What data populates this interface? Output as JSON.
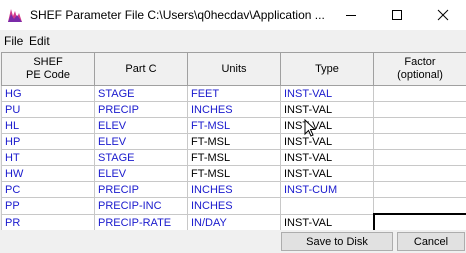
{
  "window": {
    "title": "SHEF Parameter File   C:\\Users\\q0hecdav\\Application ...",
    "icon": "hec-dss-app-icon"
  },
  "menu": [
    "File",
    "Edit"
  ],
  "table": {
    "headers": [
      {
        "line1": "SHEF",
        "line2": "PE Code"
      },
      {
        "line1": "Part C",
        "line2": ""
      },
      {
        "line1": "Units",
        "line2": ""
      },
      {
        "line1": "Type",
        "line2": ""
      },
      {
        "line1": "Factor",
        "line2": "(optional)"
      }
    ],
    "rows": [
      [
        "HG",
        "STAGE",
        "FEET",
        "INST-VAL",
        ""
      ],
      [
        "PU",
        "PRECIP",
        "INCHES",
        "INST-VAL",
        ""
      ],
      [
        "HL",
        "ELEV",
        "FT-MSL",
        "INST-VAL",
        ""
      ],
      [
        "HP",
        "ELEV",
        "FT-MSL",
        "INST-VAL",
        ""
      ],
      [
        "HT",
        "STAGE",
        "FT-MSL",
        "INST-VAL",
        ""
      ],
      [
        "HW",
        "ELEV",
        "FT-MSL",
        "INST-VAL",
        ""
      ],
      [
        "PC",
        "PRECIP",
        "INCHES",
        "INST-CUM",
        ""
      ],
      [
        "PP",
        "PRECIP-INC",
        "INCHES",
        "",
        ""
      ],
      [
        "PR",
        "PRECIP-RATE",
        "IN/DAY",
        "INST-VAL",
        ""
      ]
    ],
    "cell_colors": [
      [
        "blue",
        "blue",
        "blue",
        "blue",
        "black"
      ],
      [
        "blue",
        "blue",
        "blue",
        "black",
        "black"
      ],
      [
        "blue",
        "blue",
        "blue",
        "black",
        "black"
      ],
      [
        "blue",
        "blue",
        "black",
        "black",
        "black"
      ],
      [
        "blue",
        "blue",
        "black",
        "black",
        "black"
      ],
      [
        "blue",
        "blue",
        "black",
        "black",
        "black"
      ],
      [
        "blue",
        "blue",
        "blue",
        "blue",
        "black"
      ],
      [
        "blue",
        "blue",
        "blue",
        "black",
        "black"
      ],
      [
        "blue",
        "blue",
        "blue",
        "black",
        "black"
      ]
    ],
    "selected_cell": {
      "row": 8,
      "col": 4
    }
  },
  "buttons": {
    "save": "Save to Disk",
    "cancel": "Cancel"
  },
  "colors": {
    "data_blue": "#1a1acd",
    "header_bg": "#f0f0f0"
  }
}
